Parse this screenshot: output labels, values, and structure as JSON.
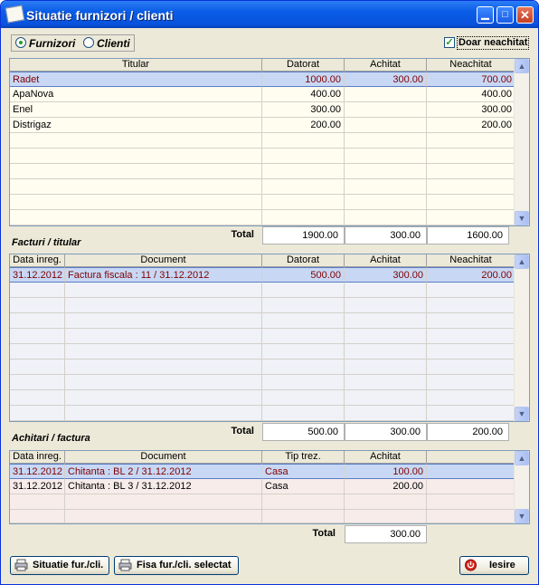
{
  "window": {
    "title": "Situatie furnizori / clienti"
  },
  "filter": {
    "option1": "Furnizori",
    "option2": "Clienti",
    "checkbox_label": "Doar neachitat"
  },
  "grid1": {
    "headers": [
      "Titular",
      "Datorat",
      "Achitat",
      "Neachitat"
    ],
    "rows": [
      [
        "Radet",
        "1000.00",
        "300.00",
        "700.00"
      ],
      [
        "ApaNova",
        "400.00",
        "",
        "400.00"
      ],
      [
        "Enel",
        "300.00",
        "",
        "300.00"
      ],
      [
        "Distrigaz",
        "200.00",
        "",
        "200.00"
      ]
    ],
    "total_label": "Total",
    "totals": [
      "1900.00",
      "300.00",
      "1600.00"
    ]
  },
  "grid2": {
    "section_label": "Facturi / titular",
    "headers": [
      "Data inreg.",
      "Document",
      "Datorat",
      "Achitat",
      "Neachitat"
    ],
    "rows": [
      [
        "31.12.2012",
        "Factura fiscala : 11 / 31.12.2012",
        "500.00",
        "300.00",
        "200.00"
      ]
    ],
    "total_label": "Total",
    "totals": [
      "500.00",
      "300.00",
      "200.00"
    ]
  },
  "grid3": {
    "section_label": "Achitari / factura",
    "headers": [
      "Data inreg.",
      "Document",
      "Tip trez.",
      "Achitat"
    ],
    "rows": [
      [
        "31.12.2012",
        "Chitanta : BL 2 / 31.12.2012",
        "Casa",
        "100.00"
      ],
      [
        "31.12.2012",
        "Chitanta : BL 3 / 31.12.2012",
        "Casa",
        "200.00"
      ]
    ],
    "total_label": "Total",
    "total": "300.00"
  },
  "buttons": {
    "situatie": "Situatie fur./cli.",
    "fisa": "Fisa fur./cli. selectat",
    "iesire": "Iesire"
  },
  "colors": {
    "selected_text": "#800000",
    "selected_bg": "#c8d8f4",
    "grid1_bg": "#fffdf0",
    "grid3_bg": "#f7ecea"
  },
  "icons": [
    "app-icon",
    "minimize-icon",
    "maximize-icon",
    "close-icon",
    "scroll-up-icon",
    "scroll-down-icon",
    "printer-icon",
    "power-icon"
  ]
}
